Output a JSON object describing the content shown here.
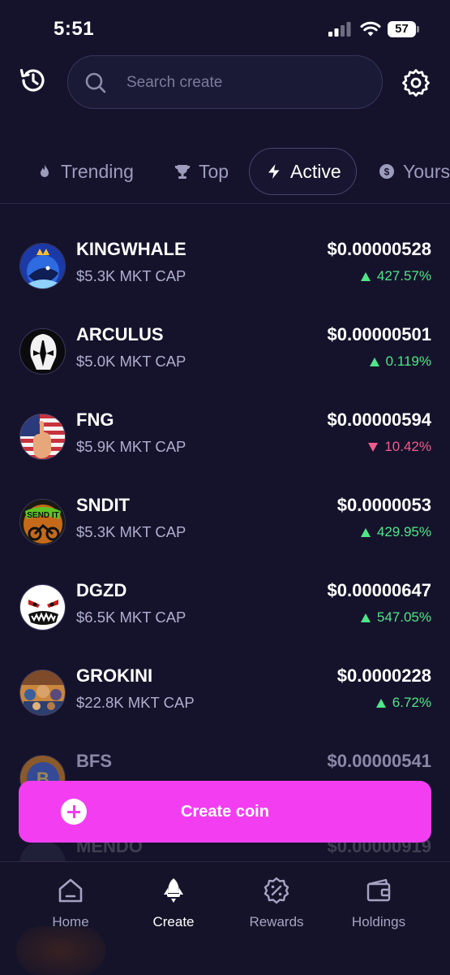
{
  "status_bar": {
    "time": "5:51",
    "battery": "57"
  },
  "search": {
    "placeholder": "Search create"
  },
  "tabs": [
    {
      "label": "Trending",
      "icon": "flame-icon",
      "active": false
    },
    {
      "label": "Top",
      "icon": "trophy-icon",
      "active": false
    },
    {
      "label": "Active",
      "icon": "lightning-icon",
      "active": true
    },
    {
      "label": "Yours",
      "icon": "coins-icon",
      "active": false
    }
  ],
  "coins": [
    {
      "name": "KINGWHALE",
      "mkt_cap": "$5.3K MKT CAP",
      "price": "$0.00000528",
      "change": "427.57%",
      "direction": "up",
      "avatar_icon": "whale-avatar"
    },
    {
      "name": "ARCULUS",
      "mkt_cap": "$5.0K MKT CAP",
      "price": "$0.00000501",
      "change": "0.119%",
      "direction": "up",
      "avatar_icon": "helmet-avatar"
    },
    {
      "name": "FNG",
      "mkt_cap": "$5.9K MKT CAP",
      "price": "$0.00000594",
      "change": "10.42%",
      "direction": "down",
      "avatar_icon": "flag-hand-avatar"
    },
    {
      "name": "SNDIT",
      "mkt_cap": "$5.3K MKT CAP",
      "price": "$0.0000053",
      "change": "429.95%",
      "direction": "up",
      "avatar_icon": "send-it-avatar"
    },
    {
      "name": "DGZD",
      "mkt_cap": "$6.5K MKT CAP",
      "price": "$0.00000647",
      "change": "547.05%",
      "direction": "up",
      "avatar_icon": "angry-face-avatar"
    },
    {
      "name": "GROKINI",
      "mkt_cap": "$22.8K MKT CAP",
      "price": "$0.0000228",
      "change": "6.72%",
      "direction": "up",
      "avatar_icon": "crowd-avatar"
    },
    {
      "name": "BFS",
      "price": "$0.00000541",
      "avatar_icon": "b-coin-avatar"
    },
    {
      "name": "MENDO",
      "price": "$0.00000919",
      "avatar_icon": "faded-avatar"
    }
  ],
  "create_button": {
    "label": "Create coin"
  },
  "nav": {
    "home": "Home",
    "create": "Create",
    "rewards": "Rewards",
    "holdings": "Holdings",
    "active": "create"
  },
  "colors": {
    "background": "#15132b",
    "accent": "#f23ef0",
    "up": "#4ee687",
    "down": "#f05b8c"
  }
}
